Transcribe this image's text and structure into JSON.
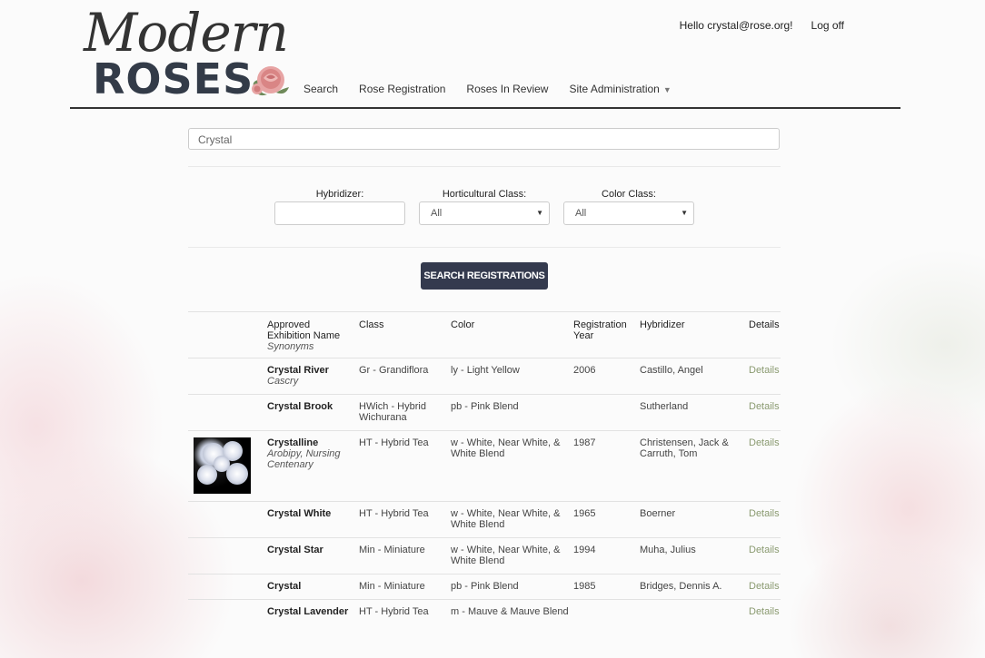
{
  "brand": {
    "script": "Modern",
    "block": "ROSES"
  },
  "nav": [
    {
      "label": "Search"
    },
    {
      "label": "Rose Registration"
    },
    {
      "label": "Roses In Review"
    },
    {
      "label": "Site Administration"
    }
  ],
  "user": {
    "greeting": "Hello crystal@rose.org!",
    "logoff": "Log off"
  },
  "search": {
    "value": "Crystal"
  },
  "filters": {
    "hybridizer_label": "Hybridizer:",
    "hybridizer_value": "",
    "hort_label": "Horticultural Class:",
    "hort_value": "All",
    "color_label": "Color Class:",
    "color_value": "All"
  },
  "search_button": "SEARCH REGISTRATIONS",
  "table": {
    "headers": {
      "name_line1": "Approved",
      "name_line2": "Exhibition Name",
      "name_synonyms": "Synonyms",
      "class": "Class",
      "color": "Color",
      "year_line1": "Registration",
      "year_line2": "Year",
      "hybridizer": "Hybridizer",
      "details": "Details"
    },
    "rows": [
      {
        "name": "Crystal River",
        "synonyms": "Cascry",
        "class": "Gr - Grandiflora",
        "color": "ly - Light Yellow",
        "year": "2006",
        "hybridizer": "Castillo, Angel",
        "details": "Details",
        "image": false
      },
      {
        "name": "Crystal Brook",
        "synonyms": "",
        "class": "HWich - Hybrid Wichurana",
        "color": "pb - Pink Blend",
        "year": "",
        "hybridizer": "Sutherland",
        "details": "Details",
        "image": false
      },
      {
        "name": "Crystalline",
        "synonyms": "Arobipy, Nursing Centenary",
        "class": "HT - Hybrid Tea",
        "color": "w - White, Near White, & White Blend",
        "year": "1987",
        "hybridizer": "Christensen, Jack & Carruth, Tom",
        "details": "Details",
        "image": true
      },
      {
        "name": "Crystal White",
        "synonyms": "",
        "class": "HT - Hybrid Tea",
        "color": "w - White, Near White, & White Blend",
        "year": "1965",
        "hybridizer": "Boerner",
        "details": "Details",
        "image": false
      },
      {
        "name": "Crystal Star",
        "synonyms": "",
        "class": "Min - Miniature",
        "color": "w - White, Near White, & White Blend",
        "year": "1994",
        "hybridizer": "Muha, Julius",
        "details": "Details",
        "image": false
      },
      {
        "name": "Crystal",
        "synonyms": "",
        "class": "Min - Miniature",
        "color": "pb - Pink Blend",
        "year": "1985",
        "hybridizer": "Bridges, Dennis A.",
        "details": "Details",
        "image": false
      },
      {
        "name": "Crystal Lavender",
        "synonyms": "",
        "class": "HT - Hybrid Tea",
        "color": "m - Mauve & Mauve Blend",
        "year": "",
        "hybridizer": "",
        "details": "Details",
        "image": false
      }
    ]
  }
}
